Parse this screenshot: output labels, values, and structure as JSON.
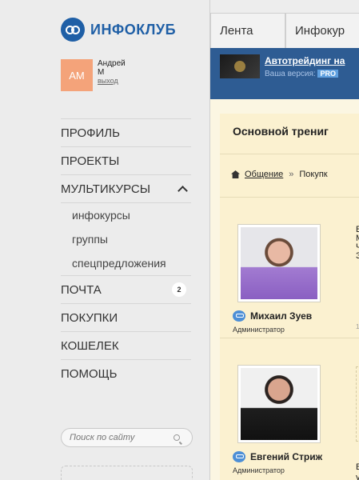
{
  "logo": {
    "text": "ИНФОКЛУБ"
  },
  "user": {
    "initials": "AM",
    "first_name": "Андрей",
    "last_name": "М",
    "logout": "выход"
  },
  "nav": {
    "profile": "ПРОФИЛЬ",
    "projects": "ПРОЕКТЫ",
    "multicourses": "МУЛЬТИКУРСЫ",
    "sub": {
      "infocourses": "инфокурсы",
      "groups": "группы",
      "special_offers": "спецпредложения"
    },
    "mail": "ПОЧТА",
    "mail_badge": "2",
    "purchases": "ПОКУПКИ",
    "wallet": "КОШЕЛЕК",
    "help": "ПОМОЩЬ"
  },
  "search": {
    "placeholder": "Поиск по сайту"
  },
  "tabs": {
    "feed": "Лента",
    "infocourses": "Инфокур"
  },
  "banner": {
    "title": "Автотрейдинг на",
    "version_label": "Ваша версия:",
    "version_badge": "PRO"
  },
  "panel": {
    "title": "Основной трениг"
  },
  "breadcrumb": {
    "first": "Общение",
    "separator": "»",
    "second": "Покупк"
  },
  "posts": [
    {
      "author": "Михаил Зуев",
      "role": "Администратор",
      "text_lines": [
        "Е",
        "М",
        "Ч",
        "З"
      ],
      "meta": "1"
    },
    {
      "author": "Евгений Стриж",
      "role": "Администратор",
      "text_lines": [
        "В",
        "у"
      ]
    }
  ],
  "colors": {
    "brand": "#1f5fa6",
    "banner_bg": "#2e5c93",
    "avatar_bg": "#f4a37a",
    "panel_bg": "#fbf1d0"
  }
}
